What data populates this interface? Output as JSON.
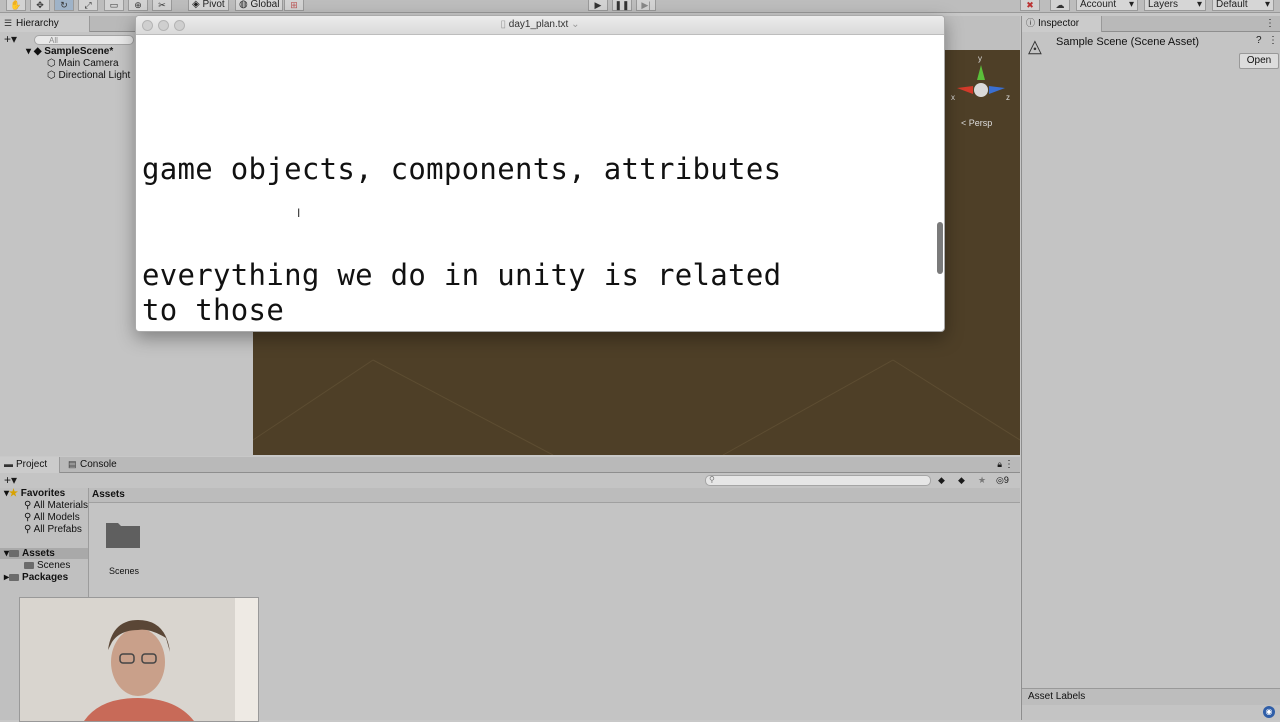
{
  "toolbar": {
    "pivot": "Pivot",
    "global": "Global",
    "account": "Account",
    "layers": "Layers",
    "layout": "Default"
  },
  "hierarchy": {
    "tab": "Hierarchy",
    "search_placeholder": "All",
    "scene": "SampleScene*",
    "items": [
      "Main Camera",
      "Directional Light"
    ]
  },
  "editor": {
    "filename": "day1_plan.txt",
    "lines": [
      "game objects, components, attributes",
      "everything we do in unity is related",
      "to those"
    ]
  },
  "scene_view": {
    "projection": "Persp",
    "axes": [
      "y",
      "x",
      "z"
    ]
  },
  "inspector": {
    "tab": "Inspector",
    "title": "Sample Scene (Scene Asset)",
    "open_button": "Open",
    "asset_labels": "Asset Labels"
  },
  "project": {
    "tabs": [
      "Project",
      "Console"
    ],
    "breadcrumb": "Assets",
    "favorites": "Favorites",
    "favorite_items": [
      "All Materials",
      "All Models",
      "All Prefabs"
    ],
    "assets": "Assets",
    "asset_children": [
      "Scenes"
    ],
    "packages": "Packages",
    "grid_items": [
      "Scenes"
    ],
    "hidden_count": "9"
  },
  "colors": {
    "panel": "#c4c4c4",
    "scene": "#4e3f27",
    "editor_bg": "#ffffff"
  }
}
